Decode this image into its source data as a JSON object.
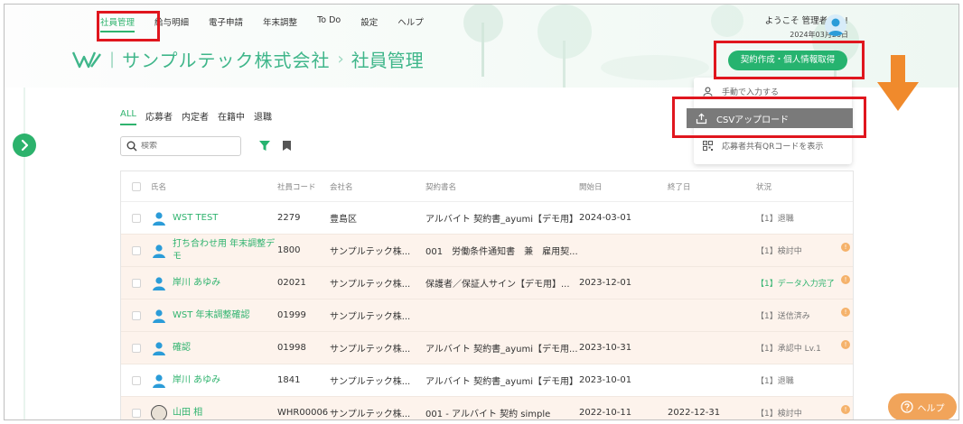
{
  "nav": {
    "items": [
      "社員管理",
      "給与明細",
      "電子申請",
      "年末調整",
      "To Do",
      "設定",
      "ヘルプ"
    ],
    "active_index": 0
  },
  "user": {
    "greeting": "ようこそ 管理者さん!",
    "date": "2024年03月26日"
  },
  "brand": {
    "company": "サンプルテック株式会社",
    "separator": "›",
    "page_title": "社員管理"
  },
  "actions": {
    "contract_button": "契約作成・個人情報取得"
  },
  "dropdown": {
    "items": [
      {
        "icon": "person-icon",
        "label": "手動で入力する"
      },
      {
        "icon": "upload-icon",
        "label": "CSVアップロード"
      },
      {
        "icon": "qr-code-icon",
        "label": "応募者共有QRコードを表示"
      }
    ]
  },
  "filters": {
    "tabs": [
      "ALL",
      "応募者",
      "内定者",
      "在籍中",
      "退職"
    ],
    "active_index": 0
  },
  "search": {
    "placeholder": "検索"
  },
  "table": {
    "headers": [
      "氏名",
      "社員コード",
      "会社名",
      "契約書名",
      "開始日",
      "終了日",
      "状況"
    ],
    "rows": [
      {
        "name": "WST TEST",
        "code": "2279",
        "company": "豊島区",
        "contract": "アルバイト 契約書_ayumi【デモ用】",
        "start": "2024-03-01",
        "end": "",
        "status": "【1】退職",
        "status_green": false,
        "warn": false,
        "highlight": false,
        "avatar": "person"
      },
      {
        "name": "打ち合わせ用 年末調整デモ",
        "code": "1800",
        "company": "サンプルテック株...",
        "contract": "001　労働条件通知書　兼　雇用契...",
        "start": "",
        "end": "",
        "status": "【1】検討中",
        "status_green": false,
        "warn": true,
        "highlight": true,
        "avatar": "person"
      },
      {
        "name": "岸川 あゆみ",
        "code": "02021",
        "company": "サンプルテック株...",
        "contract": "保護者／保証人サイン【デモ用】...",
        "start": "2023-12-01",
        "end": "",
        "status": "【1】データ入力完了",
        "status_green": true,
        "warn": true,
        "highlight": true,
        "avatar": "person"
      },
      {
        "name": "WST 年末調整確認",
        "code": "01999",
        "company": "サンプルテック株...",
        "contract": "",
        "start": "",
        "end": "",
        "status": "【1】送信済み",
        "status_green": false,
        "warn": true,
        "highlight": true,
        "avatar": "person"
      },
      {
        "name": "確認",
        "code": "01998",
        "company": "サンプルテック株...",
        "contract": "アルバイト 契約書_ayumi【デモ用...",
        "start": "2023-10-31",
        "end": "",
        "status": "【1】承認中 Lv.1",
        "status_green": false,
        "warn": true,
        "highlight": true,
        "avatar": "person"
      },
      {
        "name": "岸川 あゆみ",
        "code": "1841",
        "company": "サンプルテック株...",
        "contract": "アルバイト 契約書_ayumi【デモ用】",
        "start": "2023-10-01",
        "end": "",
        "status": "【1】退職",
        "status_green": false,
        "warn": false,
        "highlight": false,
        "avatar": "person"
      },
      {
        "name": "山田 相",
        "code": "WHR00006",
        "company": "サンプルテック株...",
        "contract": "001 - アルバイト 契約 simple",
        "start": "2022-10-11",
        "end": "2022-12-31",
        "status": "【1】検討中",
        "status_green": false,
        "warn": true,
        "highlight": true,
        "avatar": "photo"
      }
    ]
  },
  "help": {
    "label": "ヘルプ"
  },
  "colors": {
    "accent": "#2fb36e",
    "button": "#26b36f",
    "annotation": "#e0161e",
    "arrow": "#f08a2c",
    "help": "#f1a45a"
  }
}
